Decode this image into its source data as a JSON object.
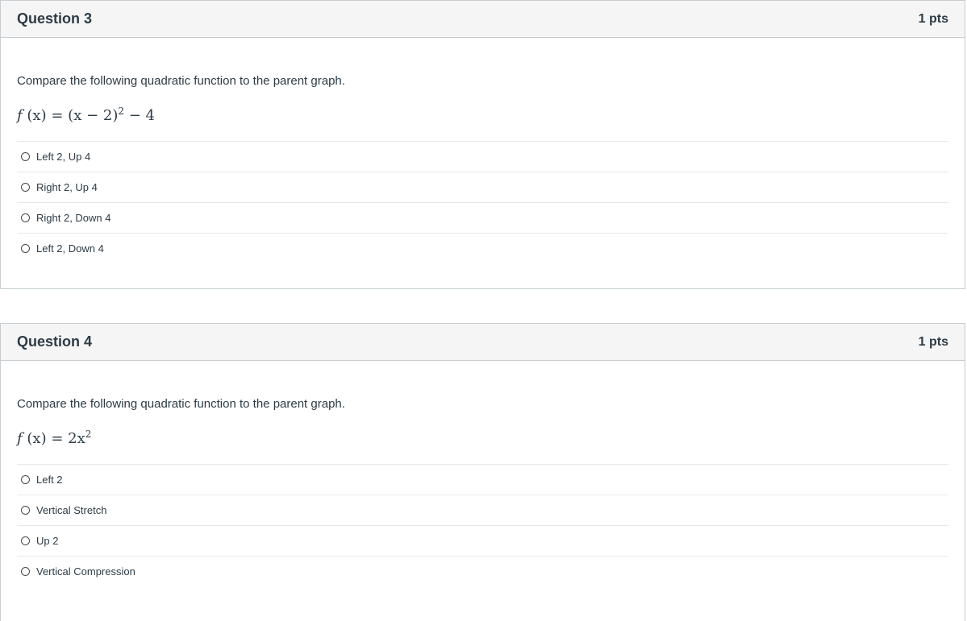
{
  "questions": [
    {
      "title": "Question 3",
      "points": "1 pts",
      "prompt": "Compare the following quadratic function to the parent graph.",
      "equation": {
        "lhs": "f",
        "lhs_arg": "(x)",
        "eq": "=",
        "rhs_main": "(x − 2)",
        "rhs_exp": "2",
        "rhs_tail": "− 4"
      },
      "answers": [
        "Left 2, Up 4",
        "Right 2, Up 4",
        "Right 2, Down 4",
        "Left 2, Down 4"
      ]
    },
    {
      "title": "Question 4",
      "points": "1 pts",
      "prompt": "Compare the following quadratic function to the parent graph.",
      "equation": {
        "lhs": "f",
        "lhs_arg": "(x)",
        "eq": "=",
        "rhs_main": "2x",
        "rhs_exp": "2",
        "rhs_tail": ""
      },
      "answers": [
        "Left 2",
        "Vertical Stretch",
        "Up 2",
        "Vertical Compression"
      ]
    }
  ]
}
